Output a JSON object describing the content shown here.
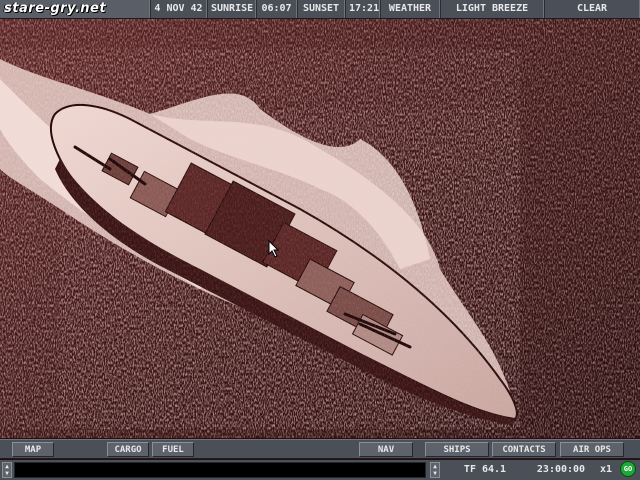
{
  "topbar": {
    "logo": "stare-gry.net",
    "date": "4 NOV 42",
    "sunrise_label": "SUNRISE",
    "sunrise_time": "06:07",
    "sunset_label": "SUNSET",
    "sunset_time": "17:21",
    "weather_label": "WEATHER",
    "weather_wind": "LIGHT BREEZE",
    "weather_sky": "CLEAR"
  },
  "viewport": {
    "subject": "aerial photo of battleship underway",
    "tint_color": "#4a1818"
  },
  "buttons": {
    "map": "MAP",
    "cargo": "CARGO",
    "fuel": "FUEL",
    "nav": "NAV",
    "ships": "SHIPS",
    "contacts": "CONTACTS",
    "air_ops": "AIR OPS"
  },
  "status": {
    "message": "",
    "task_force": "TF 64.1",
    "time": "23:00:00",
    "speed": "x1",
    "go": "GO"
  }
}
